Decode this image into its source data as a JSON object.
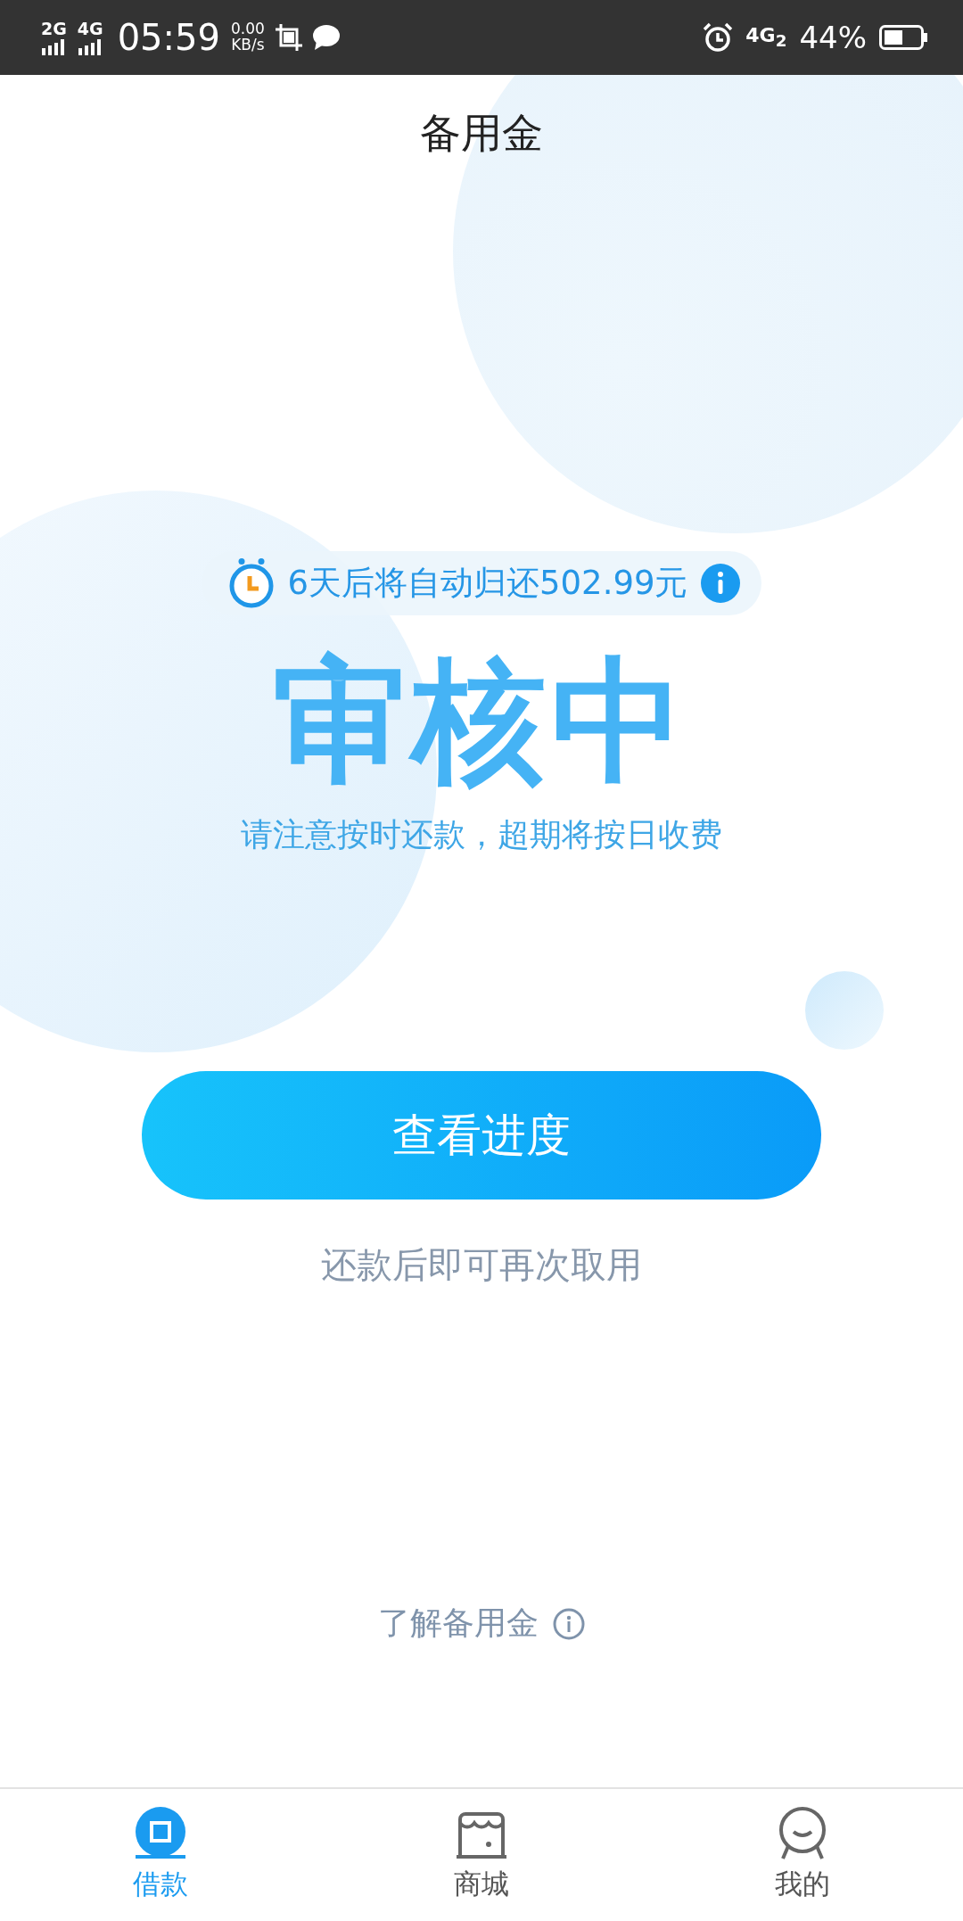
{
  "status_bar": {
    "network_1": "2G",
    "network_2": "4G",
    "time": "05:59",
    "speed": "0.00",
    "speed_unit": "KB/s",
    "sim": "4G$_{2}$",
    "battery": "44%"
  },
  "header": {
    "title": "备用金"
  },
  "notice": {
    "text": "6天后将自动归还502.99元"
  },
  "status": {
    "title": "审核中",
    "subtitle": "请注意按时还款，超期将按日收费"
  },
  "action_button": {
    "label": "查看进度"
  },
  "hint": "还款后即可再次取用",
  "learn_more": {
    "label": "了解备用金"
  },
  "tabs": [
    {
      "label": "借款",
      "kind": "loan",
      "selected": true
    },
    {
      "label": "商城",
      "kind": "shop",
      "selected": false
    },
    {
      "label": "我的",
      "kind": "profile",
      "selected": false
    }
  ]
}
